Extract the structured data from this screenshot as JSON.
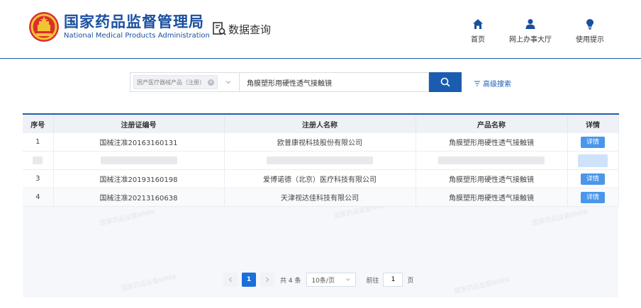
{
  "header": {
    "org_name_cn": "国家药品监督管理局",
    "org_name_en": "National Medical Products Administration",
    "section_title": "数据查询",
    "nav": [
      {
        "label": "首页",
        "icon": "home-icon"
      },
      {
        "label": "网上办事大厅",
        "icon": "user-icon"
      },
      {
        "label": "使用提示",
        "icon": "lightbulb-icon"
      }
    ]
  },
  "search": {
    "category": "国产医疗器械产品（注册）",
    "query": "角膜塑形用硬性透气接触镜",
    "advanced_label": "高级搜索"
  },
  "table": {
    "columns": [
      "序号",
      "注册证编号",
      "注册人名称",
      "产品名称",
      "详情"
    ],
    "rows": [
      {
        "index": "1",
        "reg_no": "国械注准20163160131",
        "registrant": "欧普康视科技股份有限公司",
        "product": "角膜塑形用硬性透气接触镜",
        "detail": "详情"
      },
      {
        "index": "3",
        "reg_no": "国械注准20193160198",
        "registrant": "爱博诺德（北京）医疗科技有限公司",
        "product": "角膜塑形用硬性透气接触镜",
        "detail": "详情"
      },
      {
        "index": "4",
        "reg_no": "国械注准20213160638",
        "registrant": "天津视达佳科技有限公司",
        "product": "角膜塑形用硬性透气接触镜",
        "detail": "详情"
      }
    ]
  },
  "watermark": "国家药品监督NMPA",
  "pagination": {
    "current_page": "1",
    "total": "共 4 条",
    "page_size": "10条/页",
    "goto_label": "前往",
    "goto_value": "1",
    "page_unit": "页"
  },
  "colors": {
    "brand_blue": "#1a4fa0",
    "search_button": "#1a5db0",
    "detail_button": "#4a96ea",
    "active_page": "#1a6fd9"
  }
}
